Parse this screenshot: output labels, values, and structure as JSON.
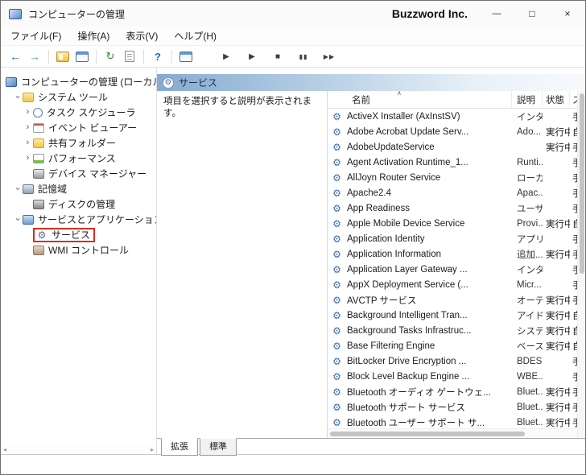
{
  "window": {
    "title": "コンピューターの管理",
    "brand": "Buzzword Inc.",
    "controls": {
      "minimize": "—",
      "maximize": "□",
      "close": "×"
    }
  },
  "menu": {
    "items": [
      "ファイル(F)",
      "操作(A)",
      "表示(V)",
      "ヘルプ(H)"
    ]
  },
  "toolbar": {
    "back": "←",
    "forward": "→",
    "refresh": "↻",
    "help": "?",
    "start": "▶",
    "resume": "▶",
    "stop": "■",
    "pause": "▮▮",
    "restart": "▶▶"
  },
  "icons": {
    "chevron": "›",
    "gear": "⚙",
    "sort": "∧",
    "scroll_left": "◂",
    "scroll_right": "▸"
  },
  "colors": {
    "annotation_red": "#dd2c1e",
    "header_blue": "#85abd0",
    "accent_blue": "#1f6fc4"
  },
  "tree": {
    "items": [
      {
        "label": "コンピューターの管理 (ローカル)"
      },
      {
        "label": "システム ツール"
      },
      {
        "label": "タスク スケジューラ"
      },
      {
        "label": "イベント ビューアー"
      },
      {
        "label": "共有フォルダー"
      },
      {
        "label": "パフォーマンス"
      },
      {
        "label": "デバイス マネージャー"
      },
      {
        "label": "記憶域"
      },
      {
        "label": "ディスクの管理"
      },
      {
        "label": "サービスとアプリケーション"
      },
      {
        "label": "サービス"
      },
      {
        "label": "WMI コントロール"
      }
    ]
  },
  "results_header": {
    "title": "サービス"
  },
  "description_panel": {
    "text": "項目を選択すると説明が表示されます。"
  },
  "services": {
    "columns": [
      {
        "label": "名前"
      },
      {
        "label": "説明"
      },
      {
        "label": "状態"
      },
      {
        "label": "ス"
      }
    ],
    "rows": [
      {
        "name": "ActiveX Installer (AxInstSV)",
        "desc": "インタ...",
        "status": "",
        "startup": "手"
      },
      {
        "name": "Adobe Acrobat Update Serv...",
        "desc": "Ado...",
        "status": "実行中",
        "startup": "自"
      },
      {
        "name": "AdobeUpdateService",
        "desc": "",
        "status": "実行中",
        "startup": "手"
      },
      {
        "name": "Agent Activation Runtime_1...",
        "desc": "Runti...",
        "status": "",
        "startup": "手"
      },
      {
        "name": "AllJoyn Router Service",
        "desc": "ローカ...",
        "status": "",
        "startup": "手"
      },
      {
        "name": "Apache2.4",
        "desc": "Apac...",
        "status": "",
        "startup": "手"
      },
      {
        "name": "App Readiness",
        "desc": "ユーザ...",
        "status": "",
        "startup": "手"
      },
      {
        "name": "Apple Mobile Device Service",
        "desc": "Provi...",
        "status": "実行中",
        "startup": "自"
      },
      {
        "name": "Application Identity",
        "desc": "アプリ...",
        "status": "",
        "startup": "手"
      },
      {
        "name": "Application Information",
        "desc": "追加...",
        "status": "実行中",
        "startup": "手"
      },
      {
        "name": "Application Layer Gateway ...",
        "desc": "インタ...",
        "status": "",
        "startup": "手"
      },
      {
        "name": "AppX Deployment Service (...",
        "desc": "Micr...",
        "status": "",
        "startup": "手"
      },
      {
        "name": "AVCTP サービス",
        "desc": "オーデ...",
        "status": "実行中",
        "startup": "手"
      },
      {
        "name": "Background Intelligent Tran...",
        "desc": "アイド...",
        "status": "実行中",
        "startup": "自"
      },
      {
        "name": "Background Tasks Infrastruc...",
        "desc": "システ...",
        "status": "実行中",
        "startup": "自"
      },
      {
        "name": "Base Filtering Engine",
        "desc": "ベース...",
        "status": "実行中",
        "startup": "自"
      },
      {
        "name": "BitLocker Drive Encryption ...",
        "desc": "BDES...",
        "status": "",
        "startup": "手"
      },
      {
        "name": "Block Level Backup Engine ...",
        "desc": "WBE...",
        "status": "",
        "startup": "手"
      },
      {
        "name": "Bluetooth オーディオ ゲートウェ...",
        "desc": "Bluet...",
        "status": "実行中",
        "startup": "手"
      },
      {
        "name": "Bluetooth サポート サービス",
        "desc": "Bluet...",
        "status": "実行中",
        "startup": "手"
      },
      {
        "name": "Bluetooth ユーザー サポート サ...",
        "desc": "Bluet...",
        "status": "実行中",
        "startup": "手"
      }
    ]
  },
  "tabs": {
    "items": [
      {
        "label": "拡張"
      },
      {
        "label": "標準"
      }
    ]
  }
}
